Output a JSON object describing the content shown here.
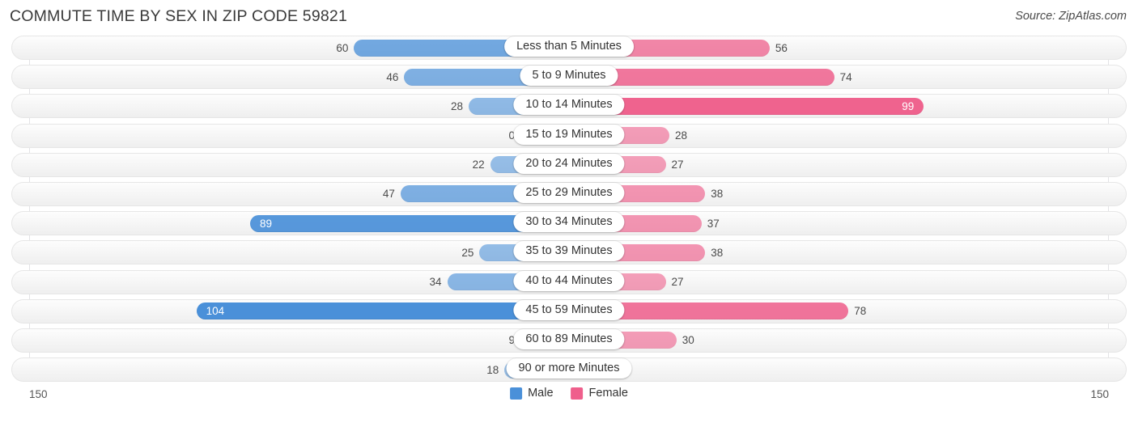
{
  "header": {
    "title": "COMMUTE TIME BY SEX IN ZIP CODE 59821",
    "source": "Source: ZipAtlas.com"
  },
  "axis": {
    "min_label": "150",
    "max_label": "150"
  },
  "legend": {
    "male_label": "Male",
    "female_label": "Female",
    "male_color": "#4a90d9",
    "female_color": "#ef5f8c"
  },
  "chart_data": {
    "type": "bar",
    "title": "COMMUTE TIME BY SEX IN ZIP CODE 59821",
    "subtitle": "Source: ZipAtlas.com",
    "orientation": "horizontal-diverging",
    "xlabel": "",
    "ylabel": "",
    "xlim": [
      150,
      150
    ],
    "axis_max": 150,
    "grid": true,
    "legend_position": "bottom-center",
    "categories": [
      "Less than 5 Minutes",
      "5 to 9 Minutes",
      "10 to 14 Minutes",
      "15 to 19 Minutes",
      "20 to 24 Minutes",
      "25 to 29 Minutes",
      "30 to 34 Minutes",
      "35 to 39 Minutes",
      "40 to 44 Minutes",
      "45 to 59 Minutes",
      "60 to 89 Minutes",
      "90 or more Minutes"
    ],
    "series": [
      {
        "name": "Male",
        "color": "#4a90d9",
        "values": [
          60,
          46,
          28,
          0,
          22,
          47,
          89,
          25,
          34,
          104,
          9,
          18
        ]
      },
      {
        "name": "Female",
        "color": "#ef5f8c",
        "values": [
          56,
          74,
          99,
          28,
          27,
          38,
          37,
          38,
          27,
          78,
          30,
          0
        ]
      }
    ]
  },
  "rows": [
    {
      "label": "Less than 5 Minutes",
      "male": "60",
      "female": "56"
    },
    {
      "label": "5 to 9 Minutes",
      "male": "46",
      "female": "74"
    },
    {
      "label": "10 to 14 Minutes",
      "male": "28",
      "female": "99"
    },
    {
      "label": "15 to 19 Minutes",
      "male": "0",
      "female": "28"
    },
    {
      "label": "20 to 24 Minutes",
      "male": "22",
      "female": "27"
    },
    {
      "label": "25 to 29 Minutes",
      "male": "47",
      "female": "38"
    },
    {
      "label": "30 to 34 Minutes",
      "male": "89",
      "female": "37"
    },
    {
      "label": "35 to 39 Minutes",
      "male": "25",
      "female": "38"
    },
    {
      "label": "40 to 44 Minutes",
      "male": "34",
      "female": "27"
    },
    {
      "label": "45 to 59 Minutes",
      "male": "104",
      "female": "78"
    },
    {
      "label": "60 to 89 Minutes",
      "male": "9",
      "female": "30"
    },
    {
      "label": "90 or more Minutes",
      "male": "18",
      "female": "0"
    }
  ]
}
